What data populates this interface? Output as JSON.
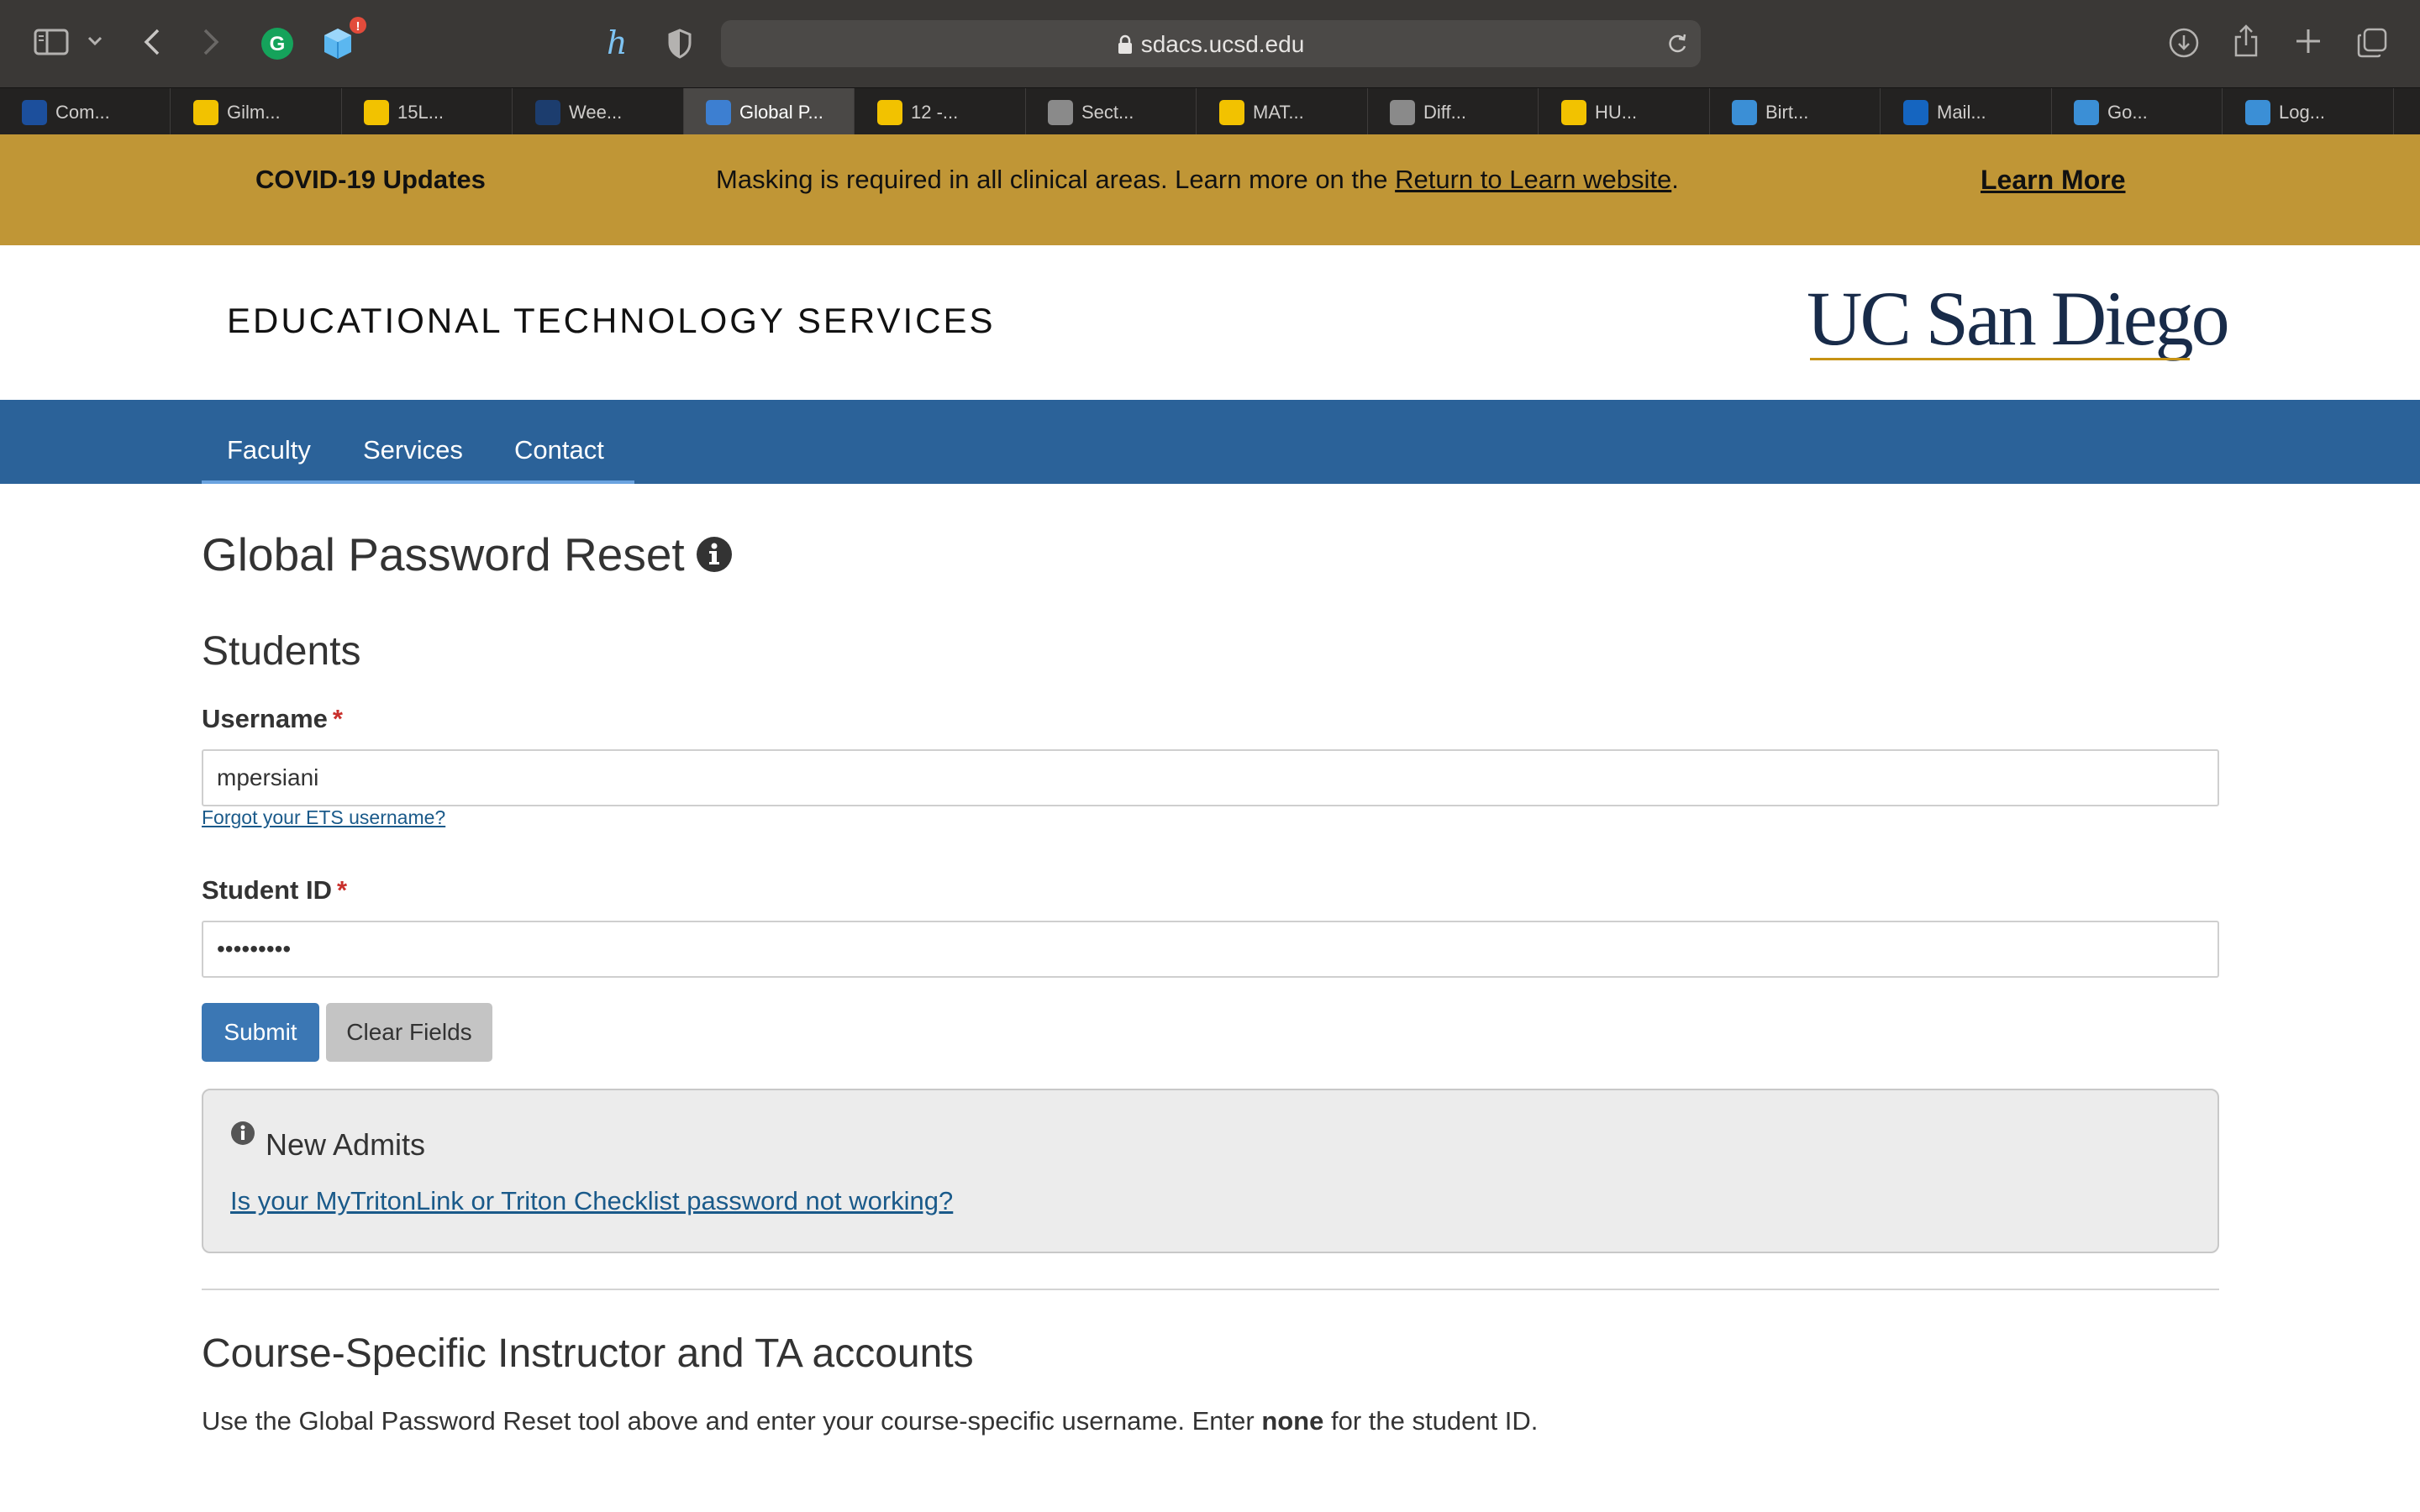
{
  "browser": {
    "url": "sdacs.ucsd.edu",
    "tabs": [
      {
        "label": "Com...",
        "icon": "ece-ucsd-icon",
        "color": "#1c4f9c",
        "active": false
      },
      {
        "label": "Gilm...",
        "icon": "canvas-stripes-icon",
        "color": "#f2c200",
        "active": false
      },
      {
        "label": "15L...",
        "icon": "canvas-stripes-icon",
        "color": "#f2c200",
        "active": false
      },
      {
        "label": "Wee...",
        "icon": "cse-icon",
        "color": "#1c3d6e",
        "active": false
      },
      {
        "label": "Global P...",
        "icon": "qualtrics-icon",
        "color": "#3d7fd1",
        "active": true
      },
      {
        "label": "12 -...",
        "icon": "canvas-stripes-icon",
        "color": "#f2c200",
        "active": false
      },
      {
        "label": "Sect...",
        "icon": "letter-z-icon",
        "color": "#8a8a8a",
        "active": false
      },
      {
        "label": "MAT...",
        "icon": "canvas-stripes-icon",
        "color": "#f2c200",
        "active": false
      },
      {
        "label": "Diff...",
        "icon": "letter-l-icon",
        "color": "#8a8a8a",
        "active": false
      },
      {
        "label": "HU...",
        "icon": "canvas-stripes-icon",
        "color": "#f2c200",
        "active": false
      },
      {
        "label": "Birt...",
        "icon": "bird-icon",
        "color": "#3b8fd6",
        "active": false
      },
      {
        "label": "Mail...",
        "icon": "outlook-icon",
        "color": "#1565c0",
        "active": false
      },
      {
        "label": "Go...",
        "icon": "gradescope-icon",
        "color": "#3b8fd6",
        "active": false
      },
      {
        "label": "Log...",
        "icon": "gradescope-icon",
        "color": "#3b8fd6",
        "active": false
      }
    ]
  },
  "banner": {
    "title": "COVID-19 Updates",
    "message_before": "Masking is required in all clinical areas. Learn more on the ",
    "message_link": "Return to Learn website",
    "message_after": ".",
    "learn_more": "Learn More"
  },
  "header": {
    "department": "EDUCATIONAL TECHNOLOGY SERVICES",
    "logo_text": "UC San Diego"
  },
  "nav": {
    "items": [
      "Faculty",
      "Services",
      "Contact"
    ]
  },
  "main": {
    "title": "Global Password Reset",
    "students_heading": "Students",
    "username_label": "Username",
    "username_value": "mpersiani",
    "forgot_link": "Forgot your ETS username?",
    "student_id_label": "Student ID",
    "student_id_value": "•••••••••",
    "required_mark": "*",
    "submit_label": "Submit",
    "clear_label": "Clear Fields",
    "new_admits": {
      "title": "New Admits",
      "link": "Is your MyTritonLink or Triton Checklist password not working?"
    },
    "course_heading": "Course-Specific Instructor and TA accounts",
    "course_text_before": "Use the Global Password Reset tool above and enter your course-specific username. Enter ",
    "course_text_bold": "none",
    "course_text_after": " for the student ID."
  },
  "colors": {
    "banner": "#c09636",
    "nav": "#2b6299",
    "submit": "#3b77b4",
    "link": "#1a5a8a",
    "logo": "#182b49",
    "logo_accent": "#c69214"
  }
}
